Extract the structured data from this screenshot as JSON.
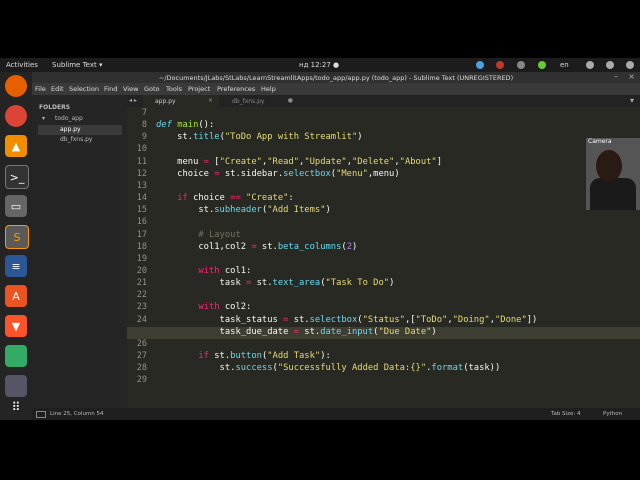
{
  "topbar": {
    "activities": "Activities",
    "app": "Sublime Text ▾",
    "clock": "нд 12:27 ●",
    "lang": "en"
  },
  "window": {
    "title": "~/Documents/JLabs/StLabs/LearnStreamlitApps/todo_app/app.py (todo_app) - Sublime Text (UNREGISTERED)"
  },
  "menu": [
    "File",
    "Edit",
    "Selection",
    "Find",
    "View",
    "Goto",
    "Tools",
    "Project",
    "Preferences",
    "Help"
  ],
  "sidebar": {
    "header": "FOLDERS",
    "folder": "todo_app",
    "files": [
      "app.py",
      "db_fxns.py"
    ]
  },
  "tabs": [
    {
      "label": "app.py",
      "close": "×"
    },
    {
      "label": "db_fxns.py",
      "close": "●"
    }
  ],
  "editor": {
    "lines": [
      {
        "n": "7",
        "html": ""
      },
      {
        "n": "8",
        "html": "<span class='df'>def</span> <span class='fname'>main</span>():"
      },
      {
        "n": "9",
        "html": "    st.<span class='fn'>title</span>(<span class='st'>\"ToDo App with Streamlit\"</span>)"
      },
      {
        "n": "10",
        "html": ""
      },
      {
        "n": "11",
        "html": "    menu <span class='kw'>=</span> [<span class='st'>\"Create\"</span>,<span class='st'>\"Read\"</span>,<span class='st'>\"Update\"</span>,<span class='st'>\"Delete\"</span>,<span class='st'>\"About\"</span>]"
      },
      {
        "n": "12",
        "html": "    choice <span class='kw'>=</span> st.sidebar.<span class='fn'>selectbox</span>(<span class='st'>\"Menu\"</span>,menu)"
      },
      {
        "n": "13",
        "html": ""
      },
      {
        "n": "14",
        "html": "    <span class='kw'>if</span> choice <span class='kw'>==</span> <span class='st'>\"Create\"</span>:"
      },
      {
        "n": "15",
        "html": "        st.<span class='fn'>subheader</span>(<span class='st'>\"Add Items\"</span>)"
      },
      {
        "n": "16",
        "html": ""
      },
      {
        "n": "17",
        "html": "        <span class='cm'># Layout</span>"
      },
      {
        "n": "18",
        "html": "        col1,col2 <span class='kw'>=</span> st.<span class='fn'>beta_columns</span>(<span class='nm'>2</span>)"
      },
      {
        "n": "19",
        "html": ""
      },
      {
        "n": "20",
        "html": "        <span class='kw'>with</span> col1:"
      },
      {
        "n": "21",
        "html": "            task <span class='kw'>=</span> st.<span class='fn'>text_area</span>(<span class='st'>\"Task To Do\"</span>)"
      },
      {
        "n": "22",
        "html": ""
      },
      {
        "n": "23",
        "html": "        <span class='kw'>with</span> col2:"
      },
      {
        "n": "24",
        "html": "            task_status <span class='kw'>=</span> st.<span class='fn'>selectbox</span>(<span class='st'>\"Status\"</span>,[<span class='st'>\"ToDo\"</span>,<span class='st'>\"Doing\"</span>,<span class='st'>\"Done\"</span>])"
      },
      {
        "n": "25",
        "html": "            task_due_date <span class='kw'>=</span> st.<span class='fn'>date_input</span>(<span class='st'>\"Due Date\"</span>)"
      },
      {
        "n": "26",
        "html": ""
      },
      {
        "n": "27",
        "html": "        <span class='kw'>if</span> st.<span class='fn'>button</span>(<span class='st'>\"Add Task\"</span>):"
      },
      {
        "n": "28",
        "html": "            st.<span class='fn'>success</span>(<span class='st'>\"Successfully Added Data:{}\"</span>.<span class='fn'>format</span>(task))"
      },
      {
        "n": "29",
        "html": ""
      }
    ],
    "current_line": "25"
  },
  "status": {
    "position": "Line 25, Column 54",
    "tabsize": "Tab Size: 4",
    "syntax": "Python"
  },
  "webcam": {
    "label": "Camera"
  },
  "colors": {
    "keyword": "#f92672",
    "function": "#66d9ef",
    "string": "#e6db74",
    "number": "#ae81ff",
    "comment": "#75715e"
  }
}
